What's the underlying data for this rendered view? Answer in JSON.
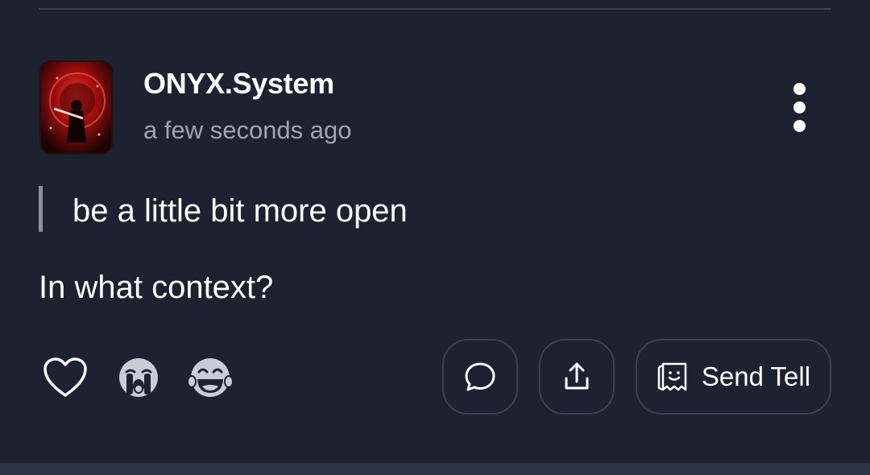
{
  "post": {
    "author": "ONYX.System",
    "timestamp": "a few seconds ago",
    "quote": "be a little bit more open",
    "reply": "In what context?"
  },
  "reactions": [
    {
      "name": "heart-icon"
    },
    {
      "name": "crying-face-icon"
    },
    {
      "name": "laughing-face-icon"
    }
  ],
  "actions": {
    "comment_icon": "speech-bubble-icon",
    "share_icon": "share-icon",
    "send_tell_label": "Send Tell",
    "send_tell_icon": "tell-card-icon"
  },
  "colors": {
    "background": "#1d2230",
    "border": "#3a4152",
    "muted_text": "#9ea4b0",
    "quote_bar": "#8a909c",
    "avatar_red": "#c81414"
  }
}
